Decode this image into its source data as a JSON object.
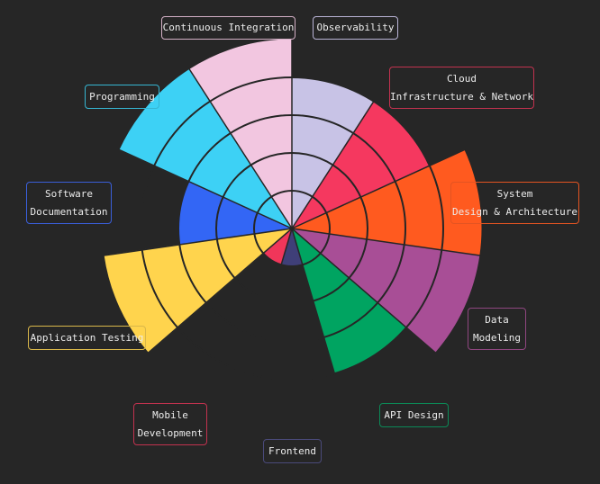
{
  "chart_data": {
    "type": "polar-area",
    "title": "",
    "categories": [
      {
        "name": "Observability",
        "lines": [
          "Observability"
        ],
        "value": 4,
        "color": "#c8c3e6",
        "border": "#b9b4d6"
      },
      {
        "name": "Cloud Infrastructure & Network",
        "lines": [
          "Cloud",
          "Infrastructure & Network"
        ],
        "value": 4,
        "color": "#f5385f",
        "border": "#c2324f"
      },
      {
        "name": "System Design & Architecture",
        "lines": [
          "System",
          "Design & Architecture"
        ],
        "value": 5,
        "color": "#ff5a1f",
        "border": "#e35422"
      },
      {
        "name": "Data Modeling",
        "lines": [
          "Data",
          "Modeling"
        ],
        "value": 5,
        "color": "#a84e96",
        "border": "#8f4680"
      },
      {
        "name": "API Design",
        "lines": [
          "API Design"
        ],
        "value": 4,
        "color": "#00a461",
        "border": "#0b8a57"
      },
      {
        "name": "Frontend",
        "lines": [
          "Frontend"
        ],
        "value": 1,
        "color": "#3f3f78",
        "border": "#4a4a7a"
      },
      {
        "name": "Mobile Development",
        "lines": [
          "Mobile",
          "Development"
        ],
        "value": 1,
        "color": "#f0365a",
        "border": "#c2324f"
      },
      {
        "name": "Application Testing",
        "lines": [
          "Application Testing"
        ],
        "value": 5,
        "color": "#ffd44d",
        "border": "#d9b74a"
      },
      {
        "name": "Software Documentation",
        "lines": [
          "Software",
          "Documentation"
        ],
        "value": 3,
        "color": "#3366f5",
        "border": "#3a5fd9"
      },
      {
        "name": "Programming",
        "lines": [
          "Programming"
        ],
        "value": 5,
        "color": "#3dd1f5",
        "border": "#36b6d2"
      },
      {
        "name": "Continuous Integration",
        "lines": [
          "Continuous Integration"
        ],
        "value": 5,
        "color": "#f2c6e0",
        "border": "#d4b0c6"
      }
    ],
    "rmax": 5,
    "grid": true,
    "gridline_color": "#262626",
    "background": "#262626",
    "legend": "none"
  }
}
